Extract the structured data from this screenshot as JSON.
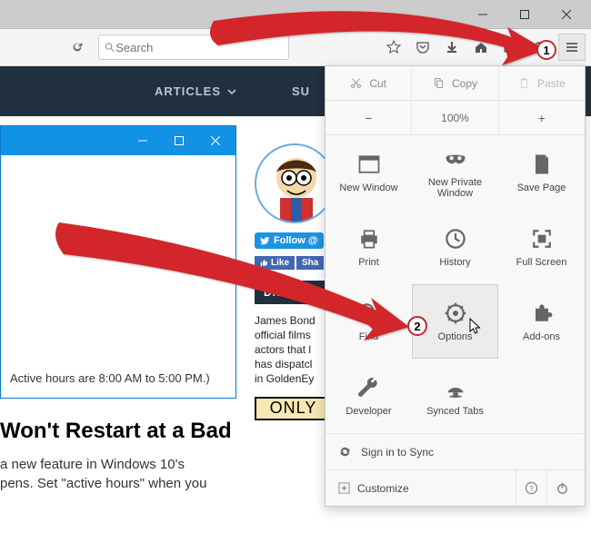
{
  "search": {
    "placeholder": "Search"
  },
  "sitenav": {
    "articles": "ARTICLES",
    "subscribe": "SU"
  },
  "dialog": {
    "footer_note": "Active hours are 8:00 AM to 5:00 PM.)"
  },
  "article": {
    "headline": "Won't Restart at a Bad",
    "para": "a new feature in Windows 10's\npens. Set \"active hours\" when you"
  },
  "social": {
    "follow": "Follow @",
    "like": "Like",
    "share": "Sha"
  },
  "didyou": {
    "label": "DID YOU KNO"
  },
  "trivia": "James Bond\nofficial films\nactors that l\nhas dispatcl\nin GoldenEy",
  "only": "ONLY",
  "menu": {
    "edit": {
      "cut": "Cut",
      "copy": "Copy",
      "paste": "Paste"
    },
    "zoom": {
      "level": "100%"
    },
    "items": {
      "new_window": "New Window",
      "new_private": "New Private\nWindow",
      "save_page": "Save Page",
      "print": "Print",
      "history": "History",
      "full_screen": "Full Screen",
      "find": "Find",
      "options": "Options",
      "addons": "Add-ons",
      "developer": "Developer",
      "synced_tabs": "Synced Tabs"
    },
    "sync": "Sign in to Sync",
    "customize": "Customize"
  },
  "callouts": {
    "one": "1",
    "two": "2"
  }
}
